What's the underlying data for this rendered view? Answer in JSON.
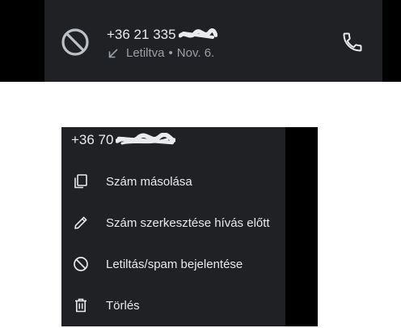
{
  "call_log_entry": {
    "number_visible": "+36 21 335",
    "status": "Letiltva",
    "separator": "•",
    "date": "Nov. 6.",
    "avatar_icon": "block-icon",
    "direction_icon": "missed-call-arrow-icon",
    "call_icon": "phone-icon"
  },
  "context_menu": {
    "header_number_visible": "+36 70",
    "items": [
      {
        "label": "Szám másolása",
        "icon": "copy-icon"
      },
      {
        "label": "Szám szerkesztése hívás előtt",
        "icon": "edit-pencil-icon"
      },
      {
        "label": "Letiltás/spam bejelentése",
        "icon": "block-icon"
      },
      {
        "label": "Törlés",
        "icon": "trash-icon"
      }
    ]
  },
  "colors": {
    "surface": "#202124",
    "backdrop": "#000000",
    "text_primary": "#e8eaed",
    "text_secondary": "#9aa0a6"
  }
}
